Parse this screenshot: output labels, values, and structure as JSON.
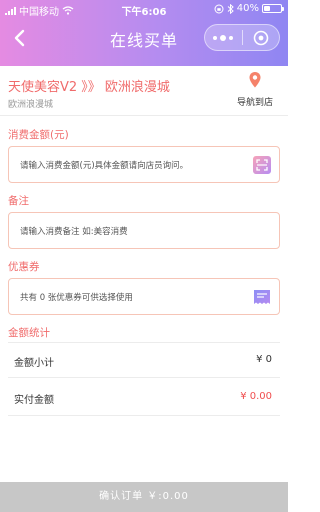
{
  "status_bar": {
    "carrier": "中国移动",
    "time": "下午6:06",
    "battery": "40%",
    "battery_level": 0.4
  },
  "navbar": {
    "title": "在线买单",
    "back_icon": "chevron-left-icon",
    "menu_icon": "more-dots-icon",
    "close_icon": "target-circle-icon"
  },
  "store": {
    "name": "天使美容V2 》》 欧洲浪漫城",
    "subtitle": "欧洲浪漫城",
    "navigate_label": "导航到店",
    "navigate_icon": "location-pin-icon"
  },
  "form": {
    "amount": {
      "label": "消费金额(元)",
      "placeholder": "请输入消费金额(元)具体金额请向店员询问。",
      "icon": "scan-icon"
    },
    "remark": {
      "label": "备注",
      "placeholder": "请输入消费备注 如:美容消费"
    },
    "coupon": {
      "label": "优惠券",
      "text": "共有 0 张优惠券可供选择使用",
      "icon": "coupon-ticket-icon"
    }
  },
  "summary": {
    "title": "金额统计",
    "subtotal_label": "金额小计",
    "subtotal_value": "¥ 0",
    "paid_label": "实付金额",
    "paid_value": "¥ 0.00"
  },
  "confirm_button": "确认订单 ￥:0.00",
  "colors": {
    "accent": "#f06b6b",
    "gradient_start": "#e58be2",
    "gradient_end": "#8f86f2",
    "field_border": "#f6c5b7",
    "button_disabled": "#c7c7c7"
  }
}
